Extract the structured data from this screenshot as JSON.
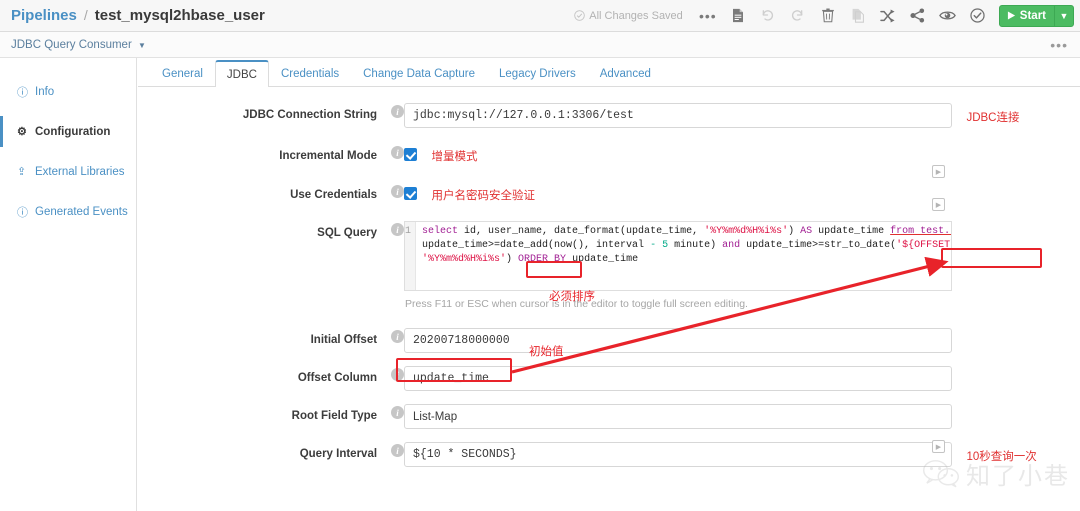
{
  "header": {
    "breadcrumb_root": "Pipelines",
    "breadcrumb_sep": "/",
    "breadcrumb_current": "test_mysql2hbase_user",
    "save_status": "All Changes Saved",
    "toolbar_icons": [
      "more-options-icon",
      "preview-document-icon",
      "undo-icon",
      "redo-icon",
      "delete-icon",
      "duplicate-icon",
      "shuffle-icon",
      "share-icon",
      "eye-icon",
      "validate-check-icon"
    ],
    "start_label": "Start",
    "start_color": "#4cbb62"
  },
  "stagebar": {
    "stage_name": "JDBC Query Consumer"
  },
  "sidebar": {
    "items": [
      {
        "label": "Info",
        "icon": "info-icon",
        "active": false
      },
      {
        "label": "Configuration",
        "icon": "gear-icon",
        "active": true
      },
      {
        "label": "External Libraries",
        "icon": "upload-icon",
        "active": false
      },
      {
        "label": "Generated Events",
        "icon": "info-icon",
        "active": false
      }
    ]
  },
  "tabs": [
    {
      "label": "General",
      "active": false
    },
    {
      "label": "JDBC",
      "active": true
    },
    {
      "label": "Credentials",
      "active": false
    },
    {
      "label": "Change Data Capture",
      "active": false
    },
    {
      "label": "Legacy Drivers",
      "active": false
    },
    {
      "label": "Advanced",
      "active": false
    }
  ],
  "form": {
    "jdbc_connection_string": {
      "label": "JDBC Connection String",
      "value": "jdbc:mysql://127.0.0.1:3306/test",
      "annotation": "JDBC连接"
    },
    "incremental_mode": {
      "label": "Incremental Mode",
      "checked": true,
      "annotation": "增量模式"
    },
    "use_credentials": {
      "label": "Use Credentials",
      "checked": true,
      "annotation": "用户名密码安全验证"
    },
    "sql_query": {
      "label": "SQL Query",
      "line_number": "1",
      "code_line_1": "select id, user_name, date_format(update_time, '%Y%m%d%H%i%s') AS update_time from test.user where",
      "code_line_2": "update_time>=date_add(now(), interval - 5 minute) and update_time>=str_to_date('${OFFSET}',",
      "code_line_3": "'%Y%m%d%H%i%s') ORDER BY update_time",
      "annotation_order_by": "必须排序",
      "highlight_order_by": "ORDER BY",
      "highlight_offset": "'${OFFSET}'",
      "hint": "Press F11 or ESC when cursor is in the editor to toggle full screen editing."
    },
    "initial_offset": {
      "label": "Initial Offset",
      "value": "20200718000000",
      "annotation": "初始值"
    },
    "offset_column": {
      "label": "Offset Column",
      "value": "update_time"
    },
    "root_field_type": {
      "label": "Root Field Type",
      "value": "List-Map"
    },
    "query_interval": {
      "label": "Query Interval",
      "value": "${10 * SECONDS}",
      "annotation": "10秒查询一次"
    }
  },
  "watermark": {
    "text": "知了小巷",
    "icon": "wechat-icon"
  },
  "colors": {
    "accent_blue": "#4a90c4",
    "annotation_red": "#e8232a",
    "checkbox_blue": "#1d7fd4",
    "start_green": "#4cbb62"
  }
}
